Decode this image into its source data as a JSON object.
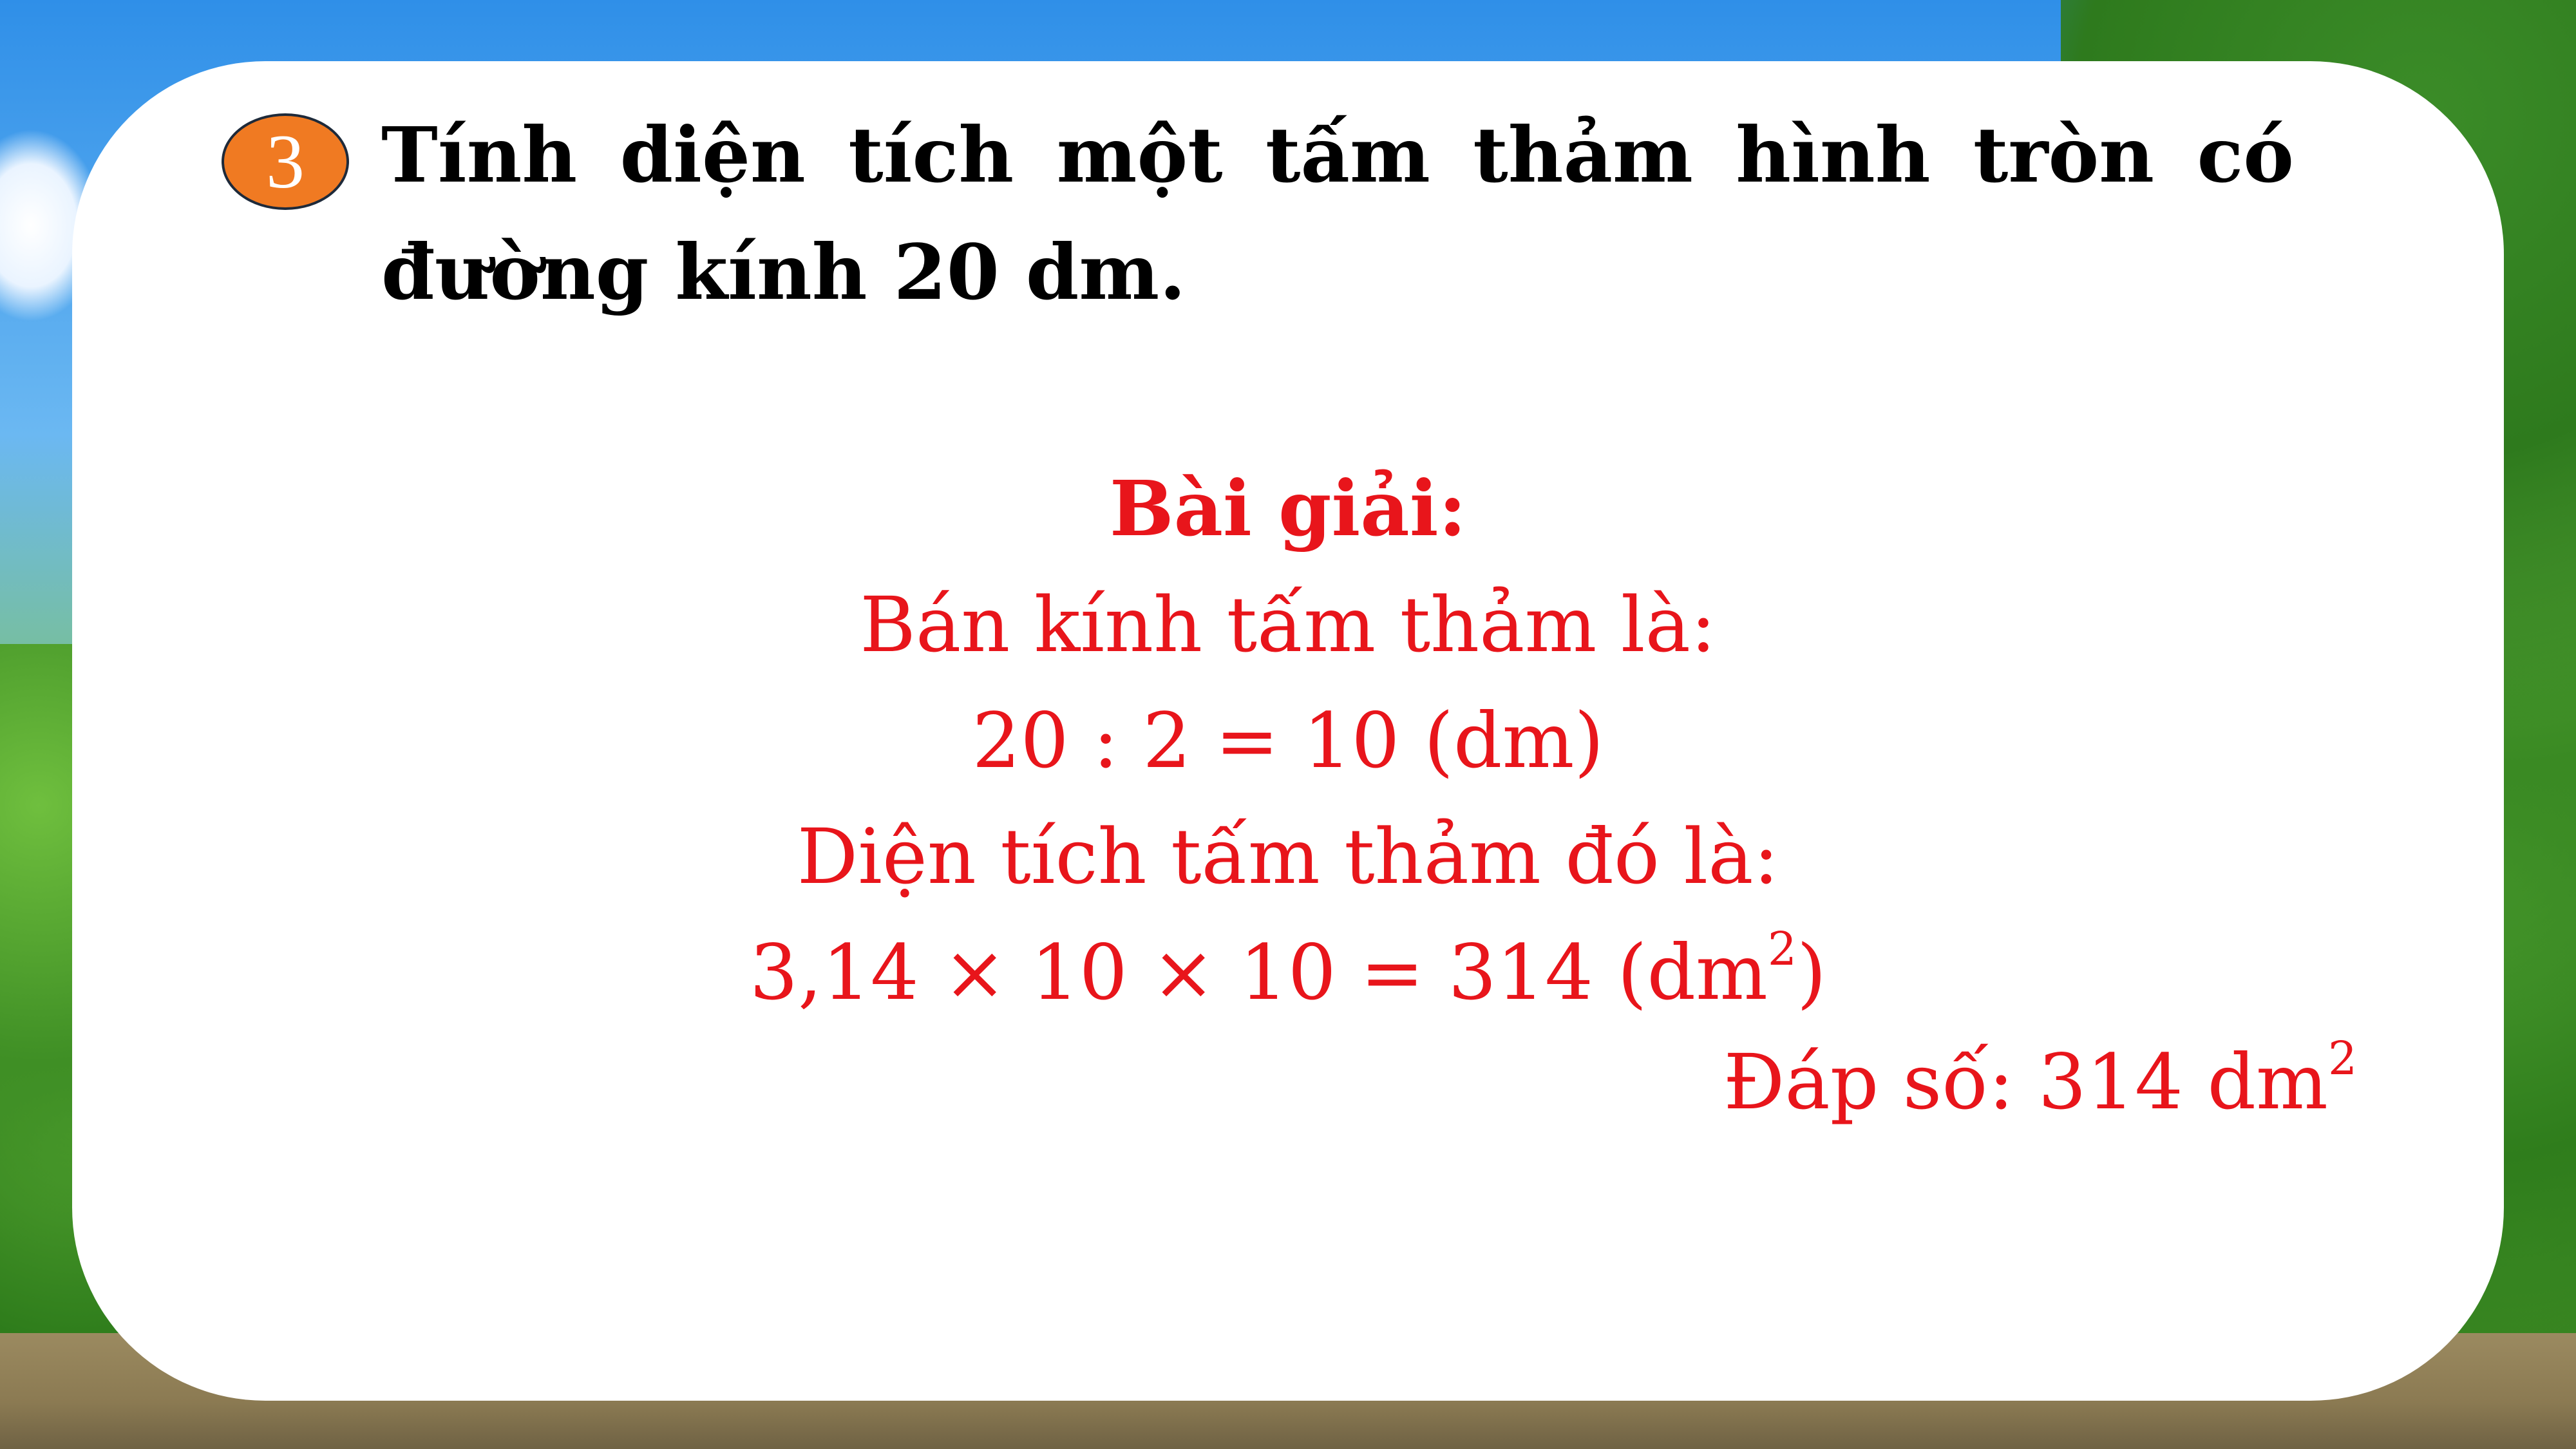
{
  "question": {
    "number": "3",
    "text": "Tính diện tích một tấm thảm hình tròn có đường kính 20 dm."
  },
  "solution": {
    "heading": "Bài giải:",
    "step1_label": "Bán kính tấm thảm là:",
    "step1_calc": "20 : 2 = 10 (dm)",
    "step2_label": "Diện tích tấm thảm đó là:",
    "step2_calc_main": "3,14 × 10 × 10 = 314 (dm",
    "step2_calc_exp": "2",
    "step2_calc_close": ")",
    "answer_main": "Đáp số: 314 dm",
    "answer_exp": "2"
  },
  "colors": {
    "badge": "#f07a22",
    "solution_text": "#e8151b",
    "question_text": "#000000"
  }
}
